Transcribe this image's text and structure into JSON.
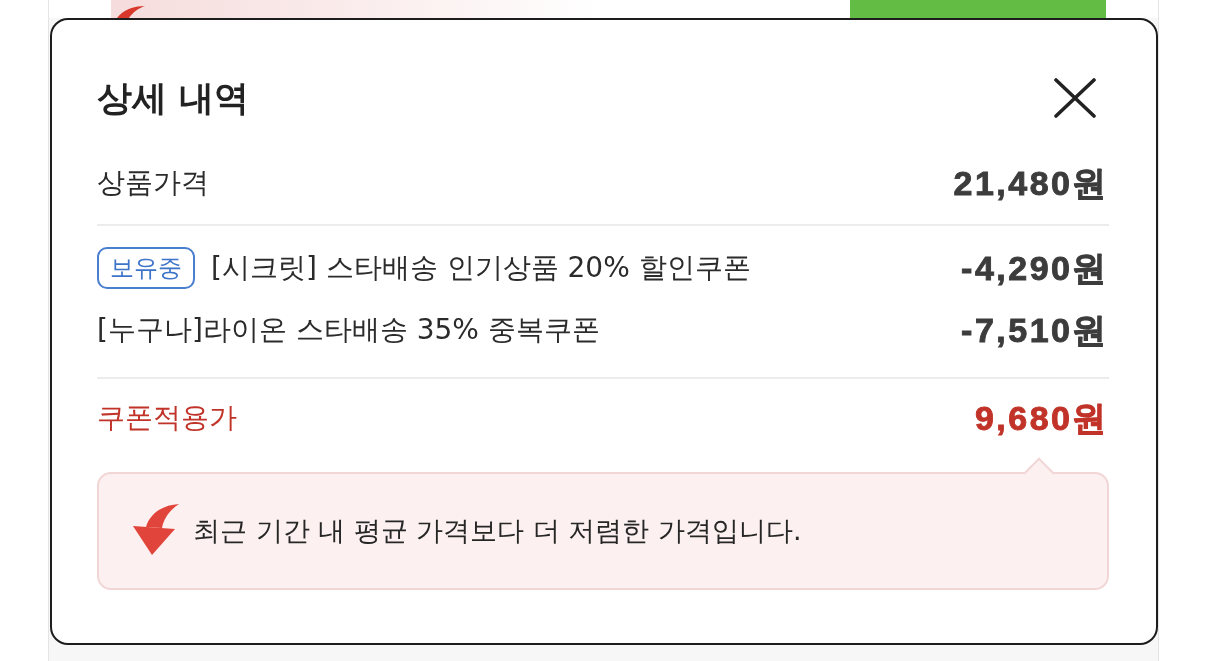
{
  "dialog": {
    "title": "상세 내역",
    "product_price": {
      "label": "상품가격",
      "value": "21,480원"
    },
    "coupons": [
      {
        "badge": "보유중",
        "name": "[시크릿] 스타배송 인기상품 20% 할인쿠폰",
        "amount": "-4,290원"
      },
      {
        "name": "[누구나]라이온 스타배송 35% 중복쿠폰",
        "amount": "-7,510원"
      }
    ],
    "final_price": {
      "label": "쿠폰적용가",
      "value": "9,680원"
    },
    "notice": {
      "text": "최근 기간 내 평균 가격보다 더 저렴한 가격입니다."
    }
  }
}
